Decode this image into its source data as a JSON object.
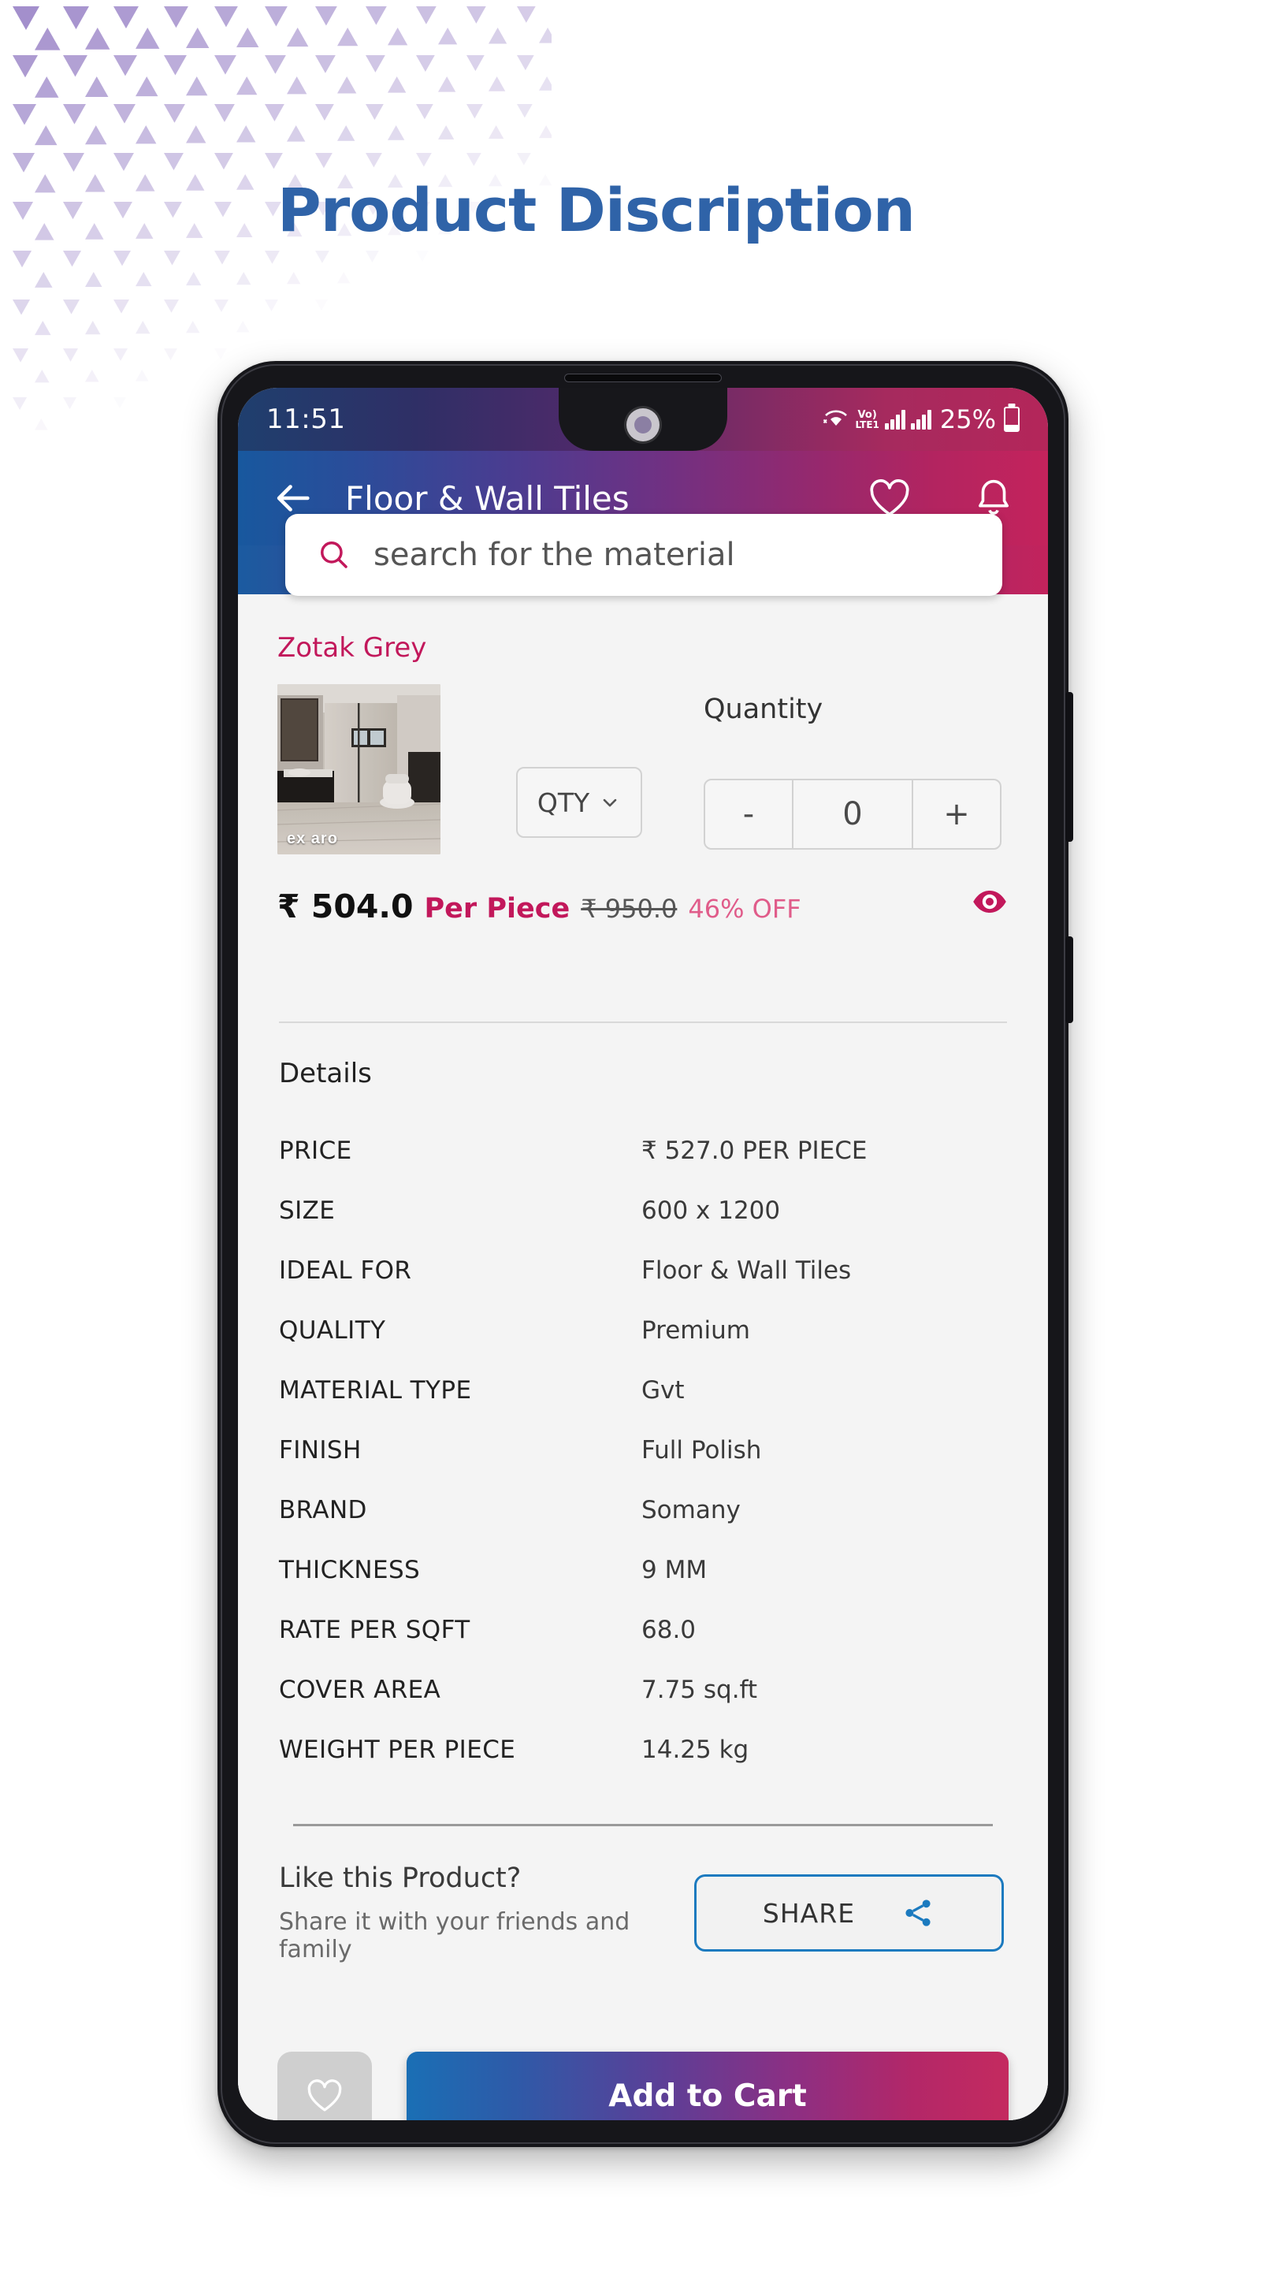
{
  "page": {
    "title": "Product Discription",
    "title_color": "#2f63a8",
    "pattern_color": "#a38fcc"
  },
  "phone": {
    "status_bar": {
      "clock": "11:51",
      "network_label": "Vo)",
      "network_sub": "LTE1",
      "battery_percent": "25%",
      "icons": [
        "wifi-icon",
        "volte-icon",
        "signal-bars-icon",
        "signal-bars-icon",
        "battery-icon"
      ]
    },
    "app_bar": {
      "back_icon": "back-arrow-icon",
      "title": "Floor & Wall Tiles",
      "wishlist_icon": "heart-icon",
      "notification_icon": "bell-icon",
      "gradient_from": "#18589e",
      "gradient_to": "#c4235c"
    },
    "search": {
      "icon": "search-icon",
      "placeholder": "search for the material",
      "value": "",
      "icon_color": "#c2185b"
    },
    "product": {
      "name": "Zotak Grey",
      "name_color": "#c2185b",
      "image_alt": "bathroom-tile-preview",
      "image_watermark": "ex aro",
      "qty_select_label": "QTY",
      "qty_select_icon": "chevron-down-icon",
      "quantity_label": "Quantity",
      "stepper": {
        "decrement": "-",
        "value": "0",
        "increment": "+"
      },
      "price": {
        "amount": "₹ 504.0",
        "unit": "Per Piece",
        "mrp": "₹ 950.0",
        "discount": "46% OFF",
        "visibility_icon": "eye-icon",
        "eye_color": "#c2185b"
      }
    },
    "details": {
      "heading": "Details",
      "rows": [
        {
          "label": "PRICE",
          "value": "₹ 527.0  PER PIECE"
        },
        {
          "label": "SIZE",
          "value": "600 x 1200"
        },
        {
          "label": "IDEAL FOR",
          "value": "Floor & Wall Tiles"
        },
        {
          "label": "QUALITY",
          "value": "Premium"
        },
        {
          "label": "MATERIAL TYPE",
          "value": "Gvt"
        },
        {
          "label": "FINISH",
          "value": "Full Polish"
        },
        {
          "label": "BRAND",
          "value": "Somany"
        },
        {
          "label": "THICKNESS",
          "value": "9 MM"
        },
        {
          "label": "RATE PER SQFT",
          "value": "68.0"
        },
        {
          "label": "COVER AREA",
          "value": "7.75 sq.ft"
        },
        {
          "label": "WEIGHT PER PIECE",
          "value": "14.25 kg"
        }
      ]
    },
    "share": {
      "headline": "Like this Product?",
      "subline": "Share it with your friends and family",
      "button_label": "SHARE",
      "button_icon": "share-nodes-icon",
      "border_color": "#1b7abf"
    },
    "bottom_bar": {
      "wishlist_icon": "heart-outline-icon",
      "add_to_cart_label": "Add to Cart",
      "cart_gradient_from": "#1a6fb5",
      "cart_gradient_to": "#c42a5f"
    }
  }
}
